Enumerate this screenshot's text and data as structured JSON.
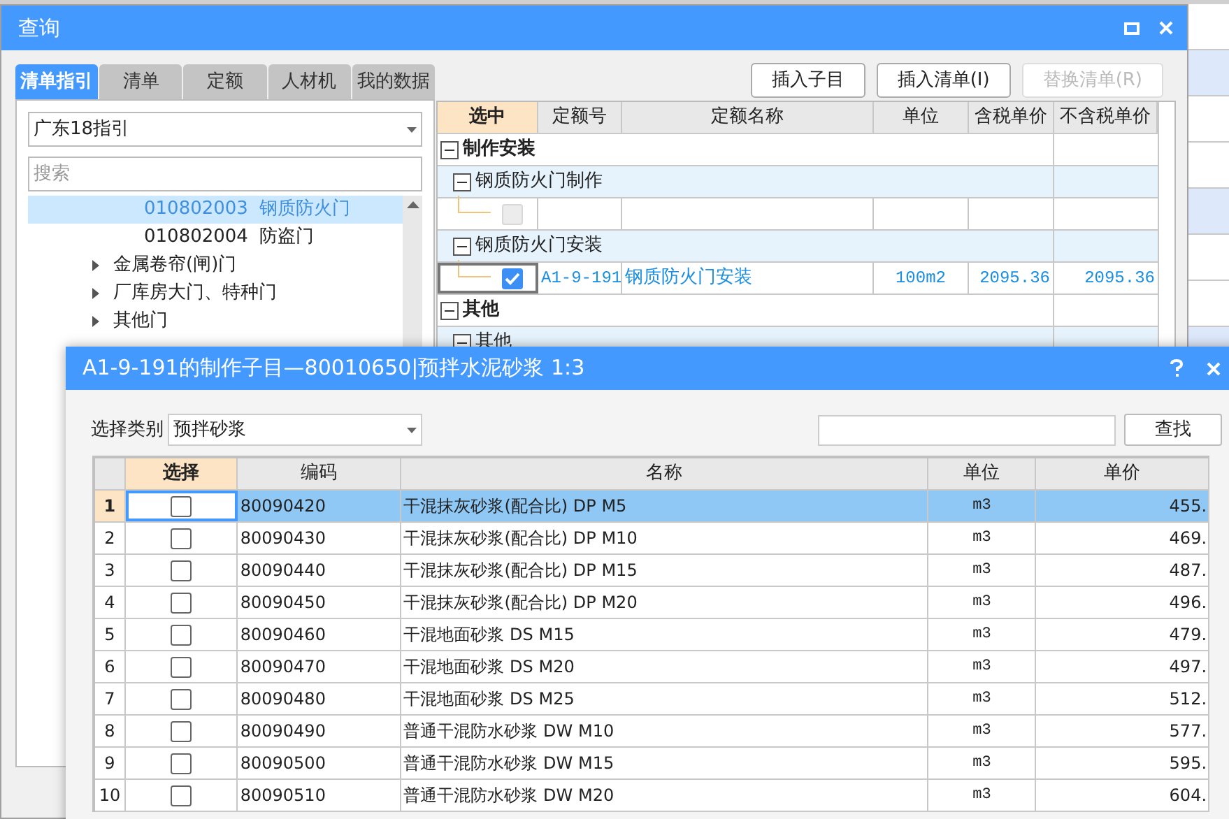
{
  "main_window": {
    "title": "查询",
    "tabs": [
      {
        "label": "清单指引",
        "selected": true
      },
      {
        "label": "清单",
        "selected": false
      },
      {
        "label": "定额",
        "selected": false
      },
      {
        "label": "人材机",
        "selected": false
      },
      {
        "label": "我的数据",
        "selected": false
      }
    ],
    "guide_select": "广东18指引",
    "search": {
      "placeholder": "搜索"
    },
    "tree": [
      {
        "kind": "entry",
        "code": "010802003",
        "name": "钢质防火门",
        "selected": true
      },
      {
        "kind": "entry",
        "code": "010802004",
        "name": "防盗门",
        "selected": false
      },
      {
        "kind": "folder",
        "label": "金属卷帘(闸)门",
        "expanded": false
      },
      {
        "kind": "folder",
        "label": "厂库房大门、特种门",
        "expanded": false
      },
      {
        "kind": "folder",
        "label": "其他门",
        "expanded": false
      }
    ],
    "buttons": [
      {
        "label": "插入子目",
        "disabled": false
      },
      {
        "label": "插入清单(I)",
        "disabled": false
      },
      {
        "label": "替换清单(R)",
        "disabled": true
      }
    ],
    "quota_table": {
      "columns": [
        "选中",
        "定额号",
        "定额名称",
        "单位",
        "含税单价",
        "不含税单价"
      ],
      "rows": [
        {
          "label": "制作安装",
          "expanded": true,
          "children": [
            {
              "label": "钢质防火门制作",
              "expanded": true,
              "children": [
                {
                  "checked": false,
                  "disabled": true
                }
              ]
            },
            {
              "label": "钢质防火门安装",
              "expanded": true,
              "children": [
                {
                  "checked": true,
                  "disabled": false,
                  "code": "A1-9-191",
                  "name": "钢质防火门安装",
                  "unit": "100m2",
                  "price_tax": "2095.36",
                  "price_notax": "2095.36"
                }
              ]
            }
          ]
        },
        {
          "label": "其他",
          "expanded": true,
          "children": [
            {
              "label": "其他",
              "expanded": true
            }
          ]
        }
      ]
    }
  },
  "dialog": {
    "title": "A1-9-191的制作子目—80010650|预拌水泥砂浆 1:3",
    "category_label": "选择类别",
    "category": "预拌砂浆",
    "find_button": "查找",
    "columns": [
      "选择",
      "编码",
      "名称",
      "单位",
      "单价"
    ],
    "rows": [
      {
        "num": "1",
        "checked": false,
        "selected": true,
        "code": "80090420",
        "name": "干混抹灰砂浆(配合比) DP M5",
        "unit": "m3",
        "price": "455."
      },
      {
        "num": "2",
        "checked": false,
        "selected": false,
        "code": "80090430",
        "name": "干混抹灰砂浆(配合比) DP M10",
        "unit": "m3",
        "price": "469."
      },
      {
        "num": "3",
        "checked": false,
        "selected": false,
        "code": "80090440",
        "name": "干混抹灰砂浆(配合比) DP M15",
        "unit": "m3",
        "price": "487."
      },
      {
        "num": "4",
        "checked": false,
        "selected": false,
        "code": "80090450",
        "name": "干混抹灰砂浆(配合比) DP M20",
        "unit": "m3",
        "price": "496."
      },
      {
        "num": "5",
        "checked": false,
        "selected": false,
        "code": "80090460",
        "name": "干混地面砂浆 DS M15",
        "unit": "m3",
        "price": "479."
      },
      {
        "num": "6",
        "checked": false,
        "selected": false,
        "code": "80090470",
        "name": "干混地面砂浆 DS M20",
        "unit": "m3",
        "price": "497."
      },
      {
        "num": "7",
        "checked": false,
        "selected": false,
        "code": "80090480",
        "name": "干混地面砂浆 DS M25",
        "unit": "m3",
        "price": "512."
      },
      {
        "num": "8",
        "checked": false,
        "selected": false,
        "code": "80090490",
        "name": "普通干混防水砂浆 DW M10",
        "unit": "m3",
        "price": "577."
      },
      {
        "num": "9",
        "checked": false,
        "selected": false,
        "code": "80090500",
        "name": "普通干混防水砂浆 DW M15",
        "unit": "m3",
        "price": "595."
      },
      {
        "num": "10",
        "checked": false,
        "selected": false,
        "code": "80090510",
        "name": "普通干混防水砂浆 DW M20",
        "unit": "m3",
        "price": "604."
      }
    ]
  }
}
